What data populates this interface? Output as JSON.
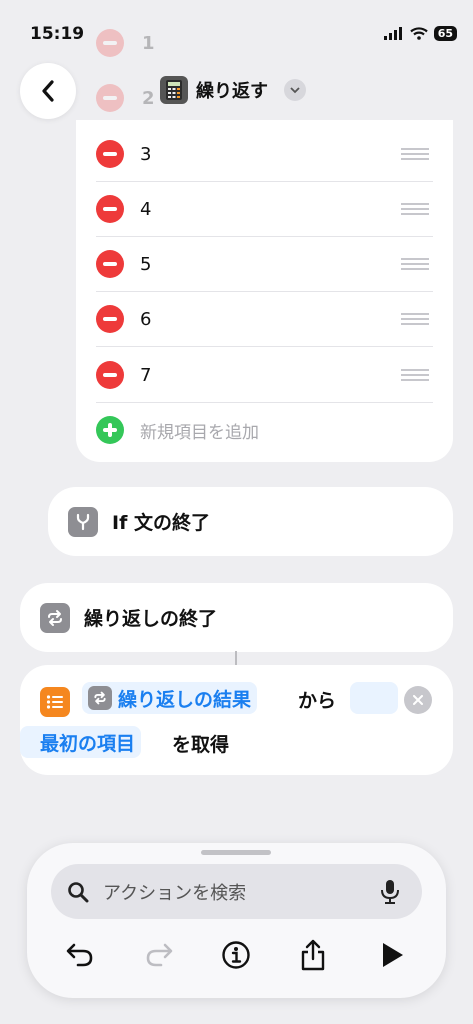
{
  "status_bar": {
    "time": "15:19",
    "battery": "65"
  },
  "header": {
    "title": "繰り返す",
    "faded_items": [
      "1",
      "2"
    ],
    "icons": {
      "back": "chevron-left-icon",
      "calculator": "calculator-icon",
      "expand": "chevron-down-icon"
    }
  },
  "list": {
    "items": [
      "3",
      "4",
      "5",
      "6",
      "7"
    ],
    "add_label": "新規項目を追加"
  },
  "blocks": {
    "end_if": "If 文の終了",
    "end_repeat": "繰り返しの終了"
  },
  "action": {
    "token_1": "繰り返しの結果",
    "text_1": "から",
    "token_2": "最初の項目",
    "text_2": "を取得"
  },
  "bottom_panel": {
    "search_placeholder": "アクションを検索",
    "tools": [
      "undo-icon",
      "redo-icon",
      "info-icon",
      "share-icon",
      "play-icon"
    ]
  },
  "colors": {
    "delete_red": "#ee3a3a",
    "add_green": "#34c759",
    "token_blue": "#1a7ff0",
    "action_orange": "#f5871f",
    "block_gray": "#8e8e93"
  }
}
